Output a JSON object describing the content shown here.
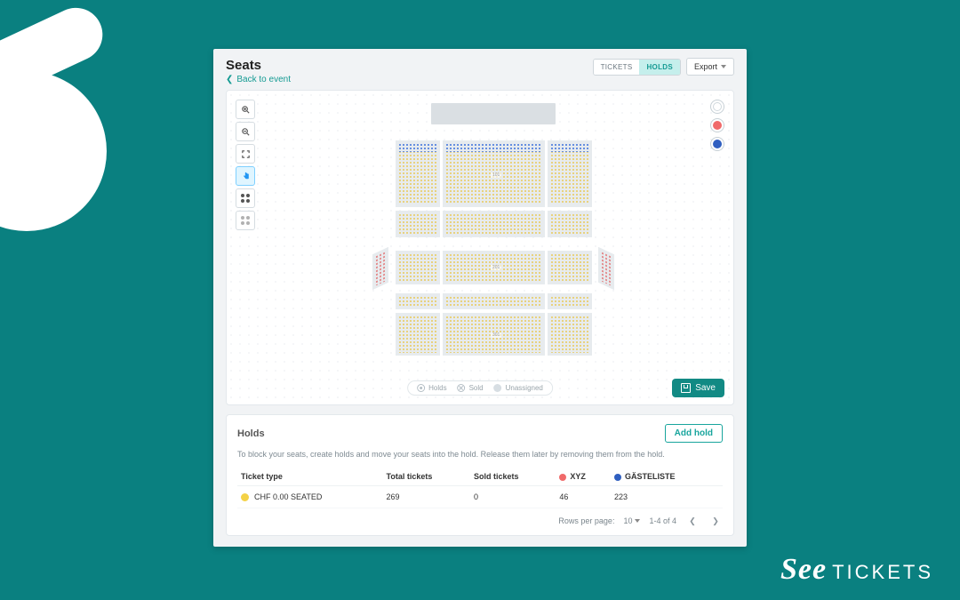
{
  "brand": {
    "see": "See",
    "tickets": "TICKETS"
  },
  "header": {
    "title": "Seats",
    "back_label": "Back to event",
    "tabs": {
      "tickets": "TICKETS",
      "holds": "HOLDS"
    },
    "export_label": "Export"
  },
  "legend_colors": [
    {
      "name": "unassigned",
      "color": "#ffffff",
      "border": "#c7d0d6"
    },
    {
      "name": "xyz",
      "color": "#f06a6a"
    },
    {
      "name": "gaesteliste",
      "color": "#2f5fc0"
    }
  ],
  "bottom_legend": {
    "holds": "Holds",
    "sold": "Sold",
    "unassigned": "Unassigned"
  },
  "save_label": "Save",
  "holds_panel": {
    "title": "Holds",
    "add_label": "Add hold",
    "description": "To block your seats, create holds and move your seats into the hold. Release them later by removing them from the hold.",
    "columns": {
      "ticket_type": "Ticket type",
      "total": "Total tickets",
      "sold": "Sold tickets",
      "hold1_label": "XYZ",
      "hold1_color": "#f06a6a",
      "hold2_label": "GÄSTELISTE",
      "hold2_color": "#2f5fc0"
    },
    "rows": [
      {
        "dot": "#f4d247",
        "type": "CHF 0.00 SEATED",
        "total": "269",
        "sold": "0",
        "h1": "46",
        "h2": "223"
      }
    ],
    "pager": {
      "rows_label": "Rows per page:",
      "per_page": "10",
      "range": "1-4 of 4"
    }
  }
}
